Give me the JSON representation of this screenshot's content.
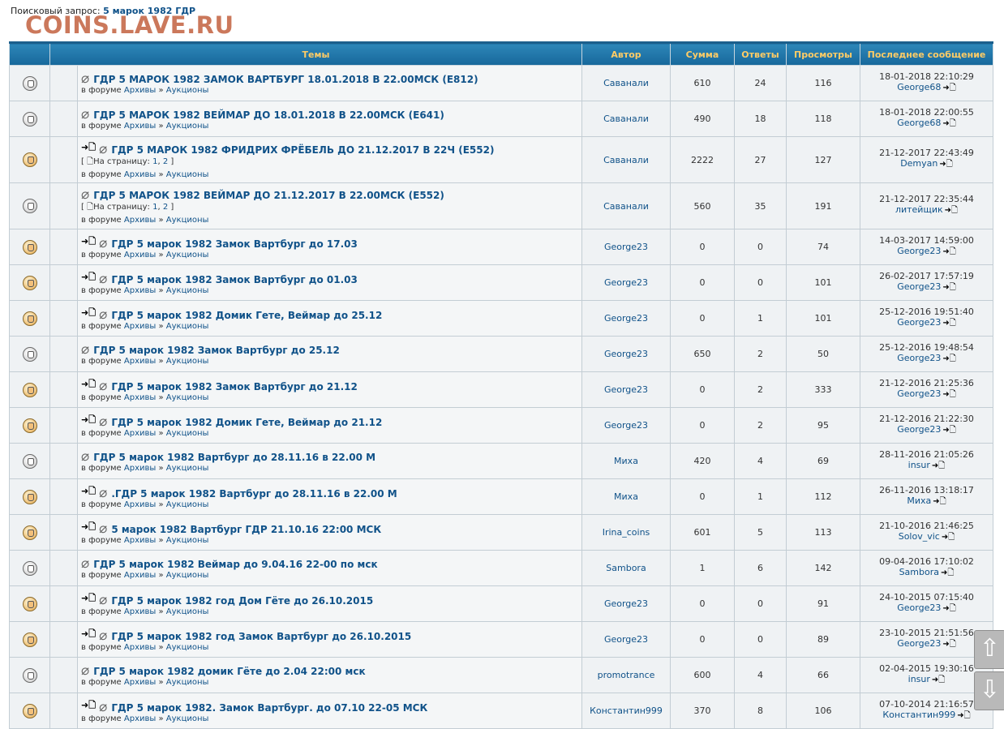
{
  "search": {
    "label": "Поисковый запрос: ",
    "query": "5 марок 1982 ГДР"
  },
  "watermark": "COINS.LAVE.RU",
  "columns": {
    "topics": "Темы",
    "author": "Автор",
    "sum": "Сумма",
    "replies": "Ответы",
    "views": "Просмотры",
    "last": "Последнее сообщение"
  },
  "labels": {
    "in_forum": "в форуме",
    "pages_prefix": "[ ",
    "pages_label": "На страницу:",
    "pages_suffix": " ]",
    "sep": "»",
    "comma": ","
  },
  "icons": {
    "folder": "folder-icon",
    "attachment": "paperclip-icon",
    "new_post": "new-post-arrow-icon",
    "goto_last": "goto-last-post-icon",
    "page": "page-icon"
  },
  "topics": [
    {
      "title": "ГДР 5 МАРОК 1982 ЗАМОК ВАРТБУРГ 18.01.2018 В 22.00МСК (E812)",
      "new": false,
      "hot": false,
      "pages": [],
      "forum": "Архивы",
      "subforum": "Аукционы",
      "author": "Саванали",
      "sum": "610",
      "replies": "24",
      "views": "116",
      "last_time": "18-01-2018 22:10:29",
      "last_user": "George68"
    },
    {
      "title": "ГДР 5 МАРОК 1982 ВЕЙМАР ДО 18.01.2018 В 22.00МСК (E641)",
      "new": false,
      "hot": false,
      "pages": [],
      "forum": "Архивы",
      "subforum": "Аукционы",
      "author": "Саванали",
      "sum": "490",
      "replies": "18",
      "views": "118",
      "last_time": "18-01-2018 22:00:55",
      "last_user": "George68"
    },
    {
      "title": "ГДР 5 МАРОК 1982 ФРИДРИХ ФРЁБЕЛЬ ДО 21.12.2017 В 22Ч (E552)",
      "new": true,
      "hot": true,
      "pages": [
        "1",
        "2"
      ],
      "forum": "Архивы",
      "subforum": "Аукционы",
      "author": "Саванали",
      "sum": "2222",
      "replies": "27",
      "views": "127",
      "last_time": "21-12-2017 22:43:49",
      "last_user": "Demyan"
    },
    {
      "title": "ГДР 5 МАРОК 1982 ВЕЙМАР ДО 21.12.2017 В 22.00МСК (E552)",
      "new": false,
      "hot": false,
      "pages": [
        "1",
        "2"
      ],
      "forum": "Архивы",
      "subforum": "Аукционы",
      "author": "Саванали",
      "sum": "560",
      "replies": "35",
      "views": "191",
      "last_time": "21-12-2017 22:35:44",
      "last_user": "литейщик"
    },
    {
      "title": "ГДР 5 марок 1982 Замок Вартбург до 17.03",
      "new": true,
      "hot": true,
      "pages": [],
      "forum": "Архивы",
      "subforum": "Аукционы",
      "author": "George23",
      "sum": "0",
      "replies": "0",
      "views": "74",
      "last_time": "14-03-2017 14:59:00",
      "last_user": "George23"
    },
    {
      "title": "ГДР 5 марок 1982 Замок Вартбург до 01.03",
      "new": true,
      "hot": true,
      "pages": [],
      "forum": "Архивы",
      "subforum": "Аукционы",
      "author": "George23",
      "sum": "0",
      "replies": "0",
      "views": "101",
      "last_time": "26-02-2017 17:57:19",
      "last_user": "George23"
    },
    {
      "title": "ГДР 5 марок 1982 Домик Гете, Веймар до 25.12",
      "new": true,
      "hot": true,
      "pages": [],
      "forum": "Архивы",
      "subforum": "Аукционы",
      "author": "George23",
      "sum": "0",
      "replies": "1",
      "views": "101",
      "last_time": "25-12-2016 19:51:40",
      "last_user": "George23"
    },
    {
      "title": "ГДР 5 марок 1982 Замок Вартбург до 25.12",
      "new": false,
      "hot": false,
      "pages": [],
      "forum": "Архивы",
      "subforum": "Аукционы",
      "author": "George23",
      "sum": "650",
      "replies": "2",
      "views": "50",
      "last_time": "25-12-2016 19:48:54",
      "last_user": "George23"
    },
    {
      "title": "ГДР 5 марок 1982 Замок Вартбург до 21.12",
      "new": true,
      "hot": true,
      "pages": [],
      "forum": "Архивы",
      "subforum": "Аукционы",
      "author": "George23",
      "sum": "0",
      "replies": "2",
      "views": "333",
      "last_time": "21-12-2016 21:25:36",
      "last_user": "George23"
    },
    {
      "title": "ГДР 5 марок 1982 Домик Гете, Веймар до 21.12",
      "new": true,
      "hot": true,
      "pages": [],
      "forum": "Архивы",
      "subforum": "Аукционы",
      "author": "George23",
      "sum": "0",
      "replies": "2",
      "views": "95",
      "last_time": "21-12-2016 21:22:30",
      "last_user": "George23"
    },
    {
      "title": "ГДР 5 марок 1982 Вартбург до 28.11.16 в 22.00 М",
      "new": false,
      "hot": false,
      "pages": [],
      "forum": "Архивы",
      "subforum": "Аукционы",
      "author": "Миха",
      "sum": "420",
      "replies": "4",
      "views": "69",
      "last_time": "28-11-2016 21:05:26",
      "last_user": "insur"
    },
    {
      "title": ".ГДР 5 марок 1982 Вартбург до 28.11.16 в 22.00 М",
      "new": true,
      "hot": true,
      "pages": [],
      "forum": "Архивы",
      "subforum": "Аукционы",
      "author": "Миха",
      "sum": "0",
      "replies": "1",
      "views": "112",
      "last_time": "26-11-2016 13:18:17",
      "last_user": "Миха"
    },
    {
      "title": "5 марок 1982 Вартбург ГДР 21.10.16 22:00 МСК",
      "new": true,
      "hot": true,
      "pages": [],
      "forum": "Архивы",
      "subforum": "Аукционы",
      "author": "Irina_coins",
      "sum": "601",
      "replies": "5",
      "views": "113",
      "last_time": "21-10-2016 21:46:25",
      "last_user": "Solov_vic"
    },
    {
      "title": "ГДР 5 марок 1982 Веймар до 9.04.16 22-00 по мск",
      "new": false,
      "hot": false,
      "pages": [],
      "forum": "Архивы",
      "subforum": "Аукционы",
      "author": "Sambora",
      "sum": "1",
      "replies": "6",
      "views": "142",
      "last_time": "09-04-2016 17:10:02",
      "last_user": "Sambora"
    },
    {
      "title": "ГДР 5 марок 1982 год Дом Гёте до 26.10.2015",
      "new": true,
      "hot": true,
      "pages": [],
      "forum": "Архивы",
      "subforum": "Аукционы",
      "author": "George23",
      "sum": "0",
      "replies": "0",
      "views": "91",
      "last_time": "24-10-2015 07:15:40",
      "last_user": "George23"
    },
    {
      "title": "ГДР 5 марок 1982 год Замок Вартбург до 26.10.2015",
      "new": true,
      "hot": true,
      "pages": [],
      "forum": "Архивы",
      "subforum": "Аукционы",
      "author": "George23",
      "sum": "0",
      "replies": "0",
      "views": "89",
      "last_time": "23-10-2015 21:51:56",
      "last_user": "George23"
    },
    {
      "title": "ГДР 5 марок 1982 домик Гёте до 2.04 22:00 мск",
      "new": false,
      "hot": false,
      "pages": [],
      "forum": "Архивы",
      "subforum": "Аукционы",
      "author": "promotrance",
      "sum": "600",
      "replies": "4",
      "views": "66",
      "last_time": "02-04-2015 19:30:16",
      "last_user": "insur"
    },
    {
      "title": "ГДР 5 марок 1982. Замок Вартбург. до 07.10 22-05 МСК",
      "new": true,
      "hot": true,
      "pages": [],
      "forum": "Архивы",
      "subforum": "Аукционы",
      "author": "Константин999",
      "sum": "370",
      "replies": "8",
      "views": "106",
      "last_time": "07-10-2014 21:16:57",
      "last_user": "Константин999"
    }
  ],
  "scroll": {
    "up_icon": "scroll-up-arrow-icon",
    "down_icon": "scroll-down-arrow-icon"
  }
}
